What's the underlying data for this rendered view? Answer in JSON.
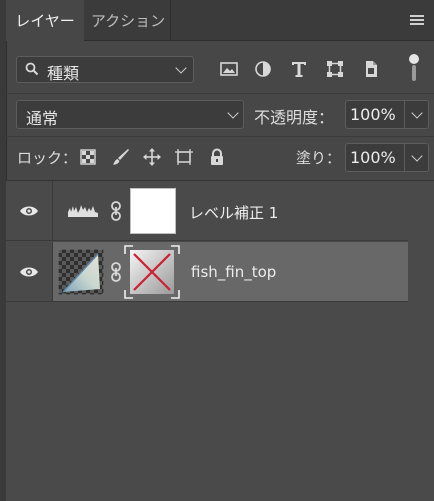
{
  "tabs": [
    {
      "label": "レイヤー",
      "active": true
    },
    {
      "label": "アクション",
      "active": false
    }
  ],
  "filter": {
    "kind_label": "種類",
    "icons": [
      "image-filter-icon",
      "adjustment-filter-icon",
      "type-filter-icon",
      "shape-filter-icon",
      "smart-object-filter-icon"
    ]
  },
  "blend": {
    "mode": "通常",
    "opacity_label": "不透明度：",
    "opacity_value": "100%"
  },
  "lock": {
    "label": "ロック：",
    "icons": [
      "lock-transparent-pixels-icon",
      "lock-image-pixels-icon",
      "lock-position-icon",
      "lock-artboard-icon",
      "lock-all-icon"
    ],
    "fill_label": "塗り：",
    "fill_value": "100%"
  },
  "layers": [
    {
      "name": "レベル補正 1",
      "type": "adjustment",
      "visible": true,
      "selected": false
    },
    {
      "name": "fish_fin_top",
      "type": "pixel",
      "visible": true,
      "selected": true
    }
  ],
  "colors": {
    "panel_bg": "#474747",
    "selected_row": "#686868",
    "mask_x": "#cc1f2e"
  }
}
